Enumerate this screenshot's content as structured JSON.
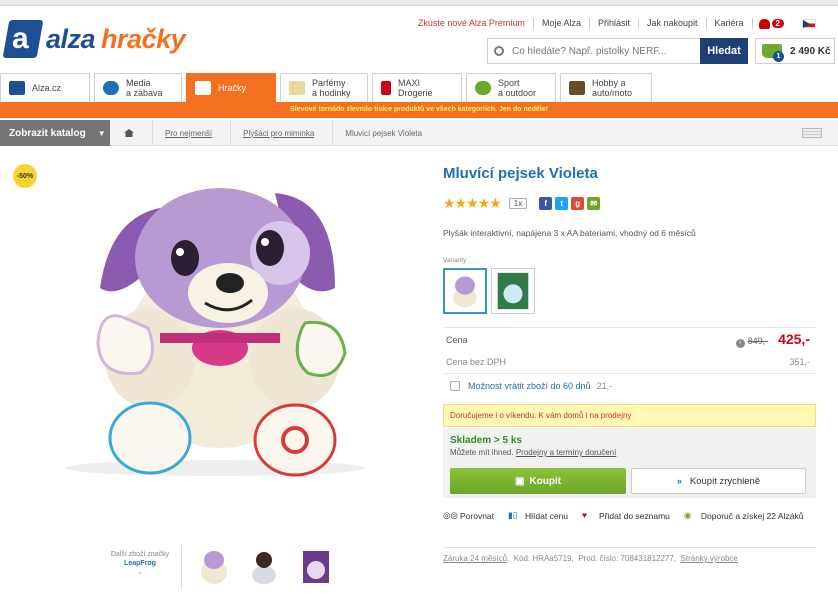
{
  "logo": {
    "mark": "a",
    "brand": "alza",
    "sub": "hračky"
  },
  "toplinks": {
    "premium": "Zkuste nové Alza Premium",
    "my": "Moje Alza",
    "login": "Přihlásit",
    "howto": "Jak nakoupit",
    "career": "Kariéra",
    "notif_count": "2"
  },
  "search": {
    "placeholder": "Co hledáte? Např. pistolky NERF...",
    "button": "Hledat"
  },
  "basket": {
    "count": "1",
    "total": "2 490 Kč"
  },
  "nav": [
    {
      "label": "Alza.cz"
    },
    {
      "label": "Media\na zábava"
    },
    {
      "label": "Hračky"
    },
    {
      "label": "Parfémy\na hodinky"
    },
    {
      "label": "MAXI\nDrogerie"
    },
    {
      "label": "Sport\na outdoor"
    },
    {
      "label": "Hobby a\nauto/moto"
    }
  ],
  "promo": "Slevové tornádo zlevnilo tisíce produktů ve všech kategoriích. Jen do neděle!",
  "catalog": "Zobrazit katalog",
  "breadcrumb": [
    "Pro nejmenší",
    "Plyšáci pro miminka",
    "Mluvicí pejsek Violeta"
  ],
  "sale_badge": "-50%",
  "brand_more": {
    "line1": "Další zboží značky",
    "brand": "LeapFrog"
  },
  "product": {
    "title": "Mluvící pejsek Violeta",
    "rating_count": "1x",
    "description": "Plyšák interaktivní, napájena 3 x AA bateriami, vhodný od 6 měsíců",
    "variants_label": "Varianty",
    "price_label": "Cena",
    "price_old": "849,-",
    "price_new": "425,-",
    "price_novat_label": "Cena bez DPH",
    "price_novat": "351,-",
    "return_label": "Možnost vrátit zboží do 60 dnů",
    "return_price": "21,-",
    "weekend_notice": "Doručujeme i o víkendu. K vám domů i na prodejny",
    "stock": "Skladem > 5 ks",
    "stock_note": "Můžete mít ihned.",
    "stock_link": "Prodejny a termíny doručení",
    "buy": "Koupit",
    "buy_fast": "Koupit zrychleně"
  },
  "actions": {
    "compare": "Porovnat",
    "watch": "Hlídat cenu",
    "wishlist": "Přidat do seznamu",
    "recommend": "Doporuč a získej 22 Alzáků"
  },
  "footer": {
    "warranty": "Záruka 24 měsíců",
    "code": "Kód: HRAa5719,",
    "prodnum": "Prod. číslo: 708431812277,",
    "pages": "Stránky výrobce"
  },
  "colors": {
    "orange": "#f37021",
    "blue": "#1d4f93",
    "green": "#6aa628",
    "red": "#d0021b"
  }
}
